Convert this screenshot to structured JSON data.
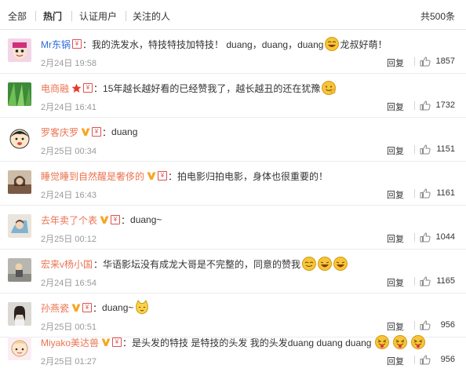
{
  "tabs": [
    {
      "label": "全部"
    },
    {
      "label": "热门"
    },
    {
      "label": "认证用户"
    },
    {
      "label": "关注的人"
    }
  ],
  "total": "共500条",
  "reply_label": "回复",
  "colors": {
    "username": "#eb7350",
    "username_blue": "#2d6be0",
    "meta": "#999999",
    "text": "#333333"
  },
  "comments": [
    {
      "user": "Mr东锅",
      "badges": [
        "red-icon"
      ],
      "text": "我的洗发水，特技特技加特技！ duang，duang，duang",
      "text2": "龙叔好萌！",
      "emoji_mid": "laugh-face-icon",
      "time": "2月24日 19:58",
      "likes": "1857"
    },
    {
      "user": "电商融",
      "badges": [
        "star-icon",
        "red-icon"
      ],
      "text": "15年越长越好看的已经赞我了，越长越丑的还在犹豫",
      "emoji_end": "smile-face-icon",
      "time": "2月24日 16:41",
      "likes": "1732"
    },
    {
      "user": "罗客庆罗",
      "badges": [
        "vip-icon",
        "red-icon"
      ],
      "text": "duang",
      "time": "2月25日 00:34",
      "likes": "1151"
    },
    {
      "user": "睡觉睡到自然醒是奢侈的",
      "badges": [
        "vip-icon",
        "red-icon"
      ],
      "text": "拍电影归拍电影，身体也很重要的！",
      "time": "2月24日 16:43",
      "likes": "1161"
    },
    {
      "user": "去年卖了个表",
      "badges": [
        "vip-icon",
        "red-icon"
      ],
      "text": "duang~",
      "time": "2月25日 00:12",
      "likes": "1044"
    },
    {
      "user": "宏来v杨小国",
      "badges": [],
      "text": "华语影坛没有成龙大哥是不完整的，同意的赞我",
      "emoji_end": "grin-faces-icon",
      "time": "2月24日 16:54",
      "likes": "1165"
    },
    {
      "user": "孙燕瓷",
      "badges": [
        "vip-icon",
        "red-icon"
      ],
      "text": "duang~",
      "emoji_end": "cat-face-icon",
      "time": "2月25日 00:51",
      "likes": "956"
    },
    {
      "user": "Miyako美达兽",
      "badges": [
        "vip-icon",
        "red-icon"
      ],
      "text": "是头发的特技 是特技的头发 我的头发duang duang duang",
      "emoji_end": "tongue-faces-icon",
      "time": "2月25日 01:27",
      "likes": "956"
    }
  ]
}
